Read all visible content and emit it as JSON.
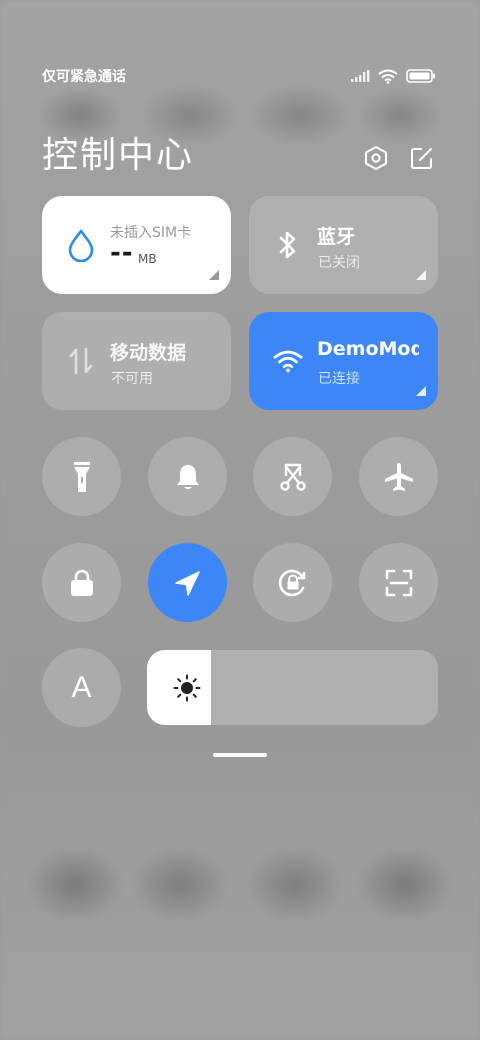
{
  "status_bar": {
    "carrier_text": "仅可紧急通话",
    "icons": [
      "signal-icon",
      "wifi-icon",
      "battery-icon"
    ]
  },
  "header": {
    "title": "控制中心",
    "icons": [
      "settings-icon",
      "edit-icon"
    ]
  },
  "tiles": {
    "data_usage": {
      "title": "未插入SIM卡",
      "value": "--",
      "unit": "MB",
      "icon": "water-drop-icon",
      "accent": "#2a8de8"
    },
    "bluetooth": {
      "title": "蓝牙",
      "status": "已关闭",
      "icon": "bluetooth-icon"
    },
    "mobile_data": {
      "title": "移动数据",
      "status": "不可用",
      "icon": "mobile-data-icon"
    },
    "wifi": {
      "title": "DemoMode",
      "status": "已连接",
      "icon": "wifi-icon",
      "color": "#3c86f8"
    }
  },
  "toggles_row1": [
    {
      "name": "flashlight",
      "icon": "flashlight-icon",
      "active": false
    },
    {
      "name": "ringer",
      "icon": "bell-icon",
      "active": false
    },
    {
      "name": "screenshot",
      "icon": "scissors-icon",
      "active": false
    },
    {
      "name": "airplane-mode",
      "icon": "airplane-icon",
      "active": false
    }
  ],
  "toggles_row2": [
    {
      "name": "lock-screen",
      "icon": "lock-icon",
      "active": false
    },
    {
      "name": "location",
      "icon": "location-arrow-icon",
      "active": true
    },
    {
      "name": "rotation-lock",
      "icon": "rotation-lock-icon",
      "active": false
    },
    {
      "name": "scanner",
      "icon": "scan-icon",
      "active": false
    }
  ],
  "font_button": {
    "label": "A",
    "icon": "font-size-icon"
  },
  "brightness": {
    "level": 0.22,
    "icon": "sun-icon"
  },
  "colors": {
    "accent_blue": "#3c86f8",
    "tile_white": "#ffffff"
  }
}
